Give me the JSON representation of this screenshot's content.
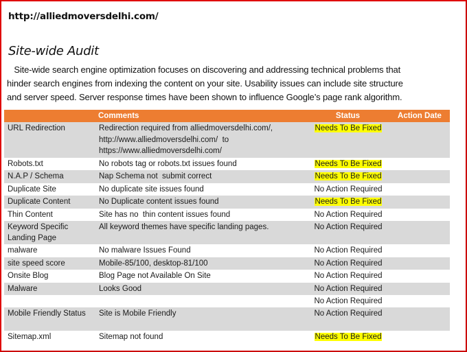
{
  "header": {
    "url": "http://alliedmoversdelhi.com/",
    "title": "Site-wide Audit"
  },
  "intro": {
    "lines": [
      "   Site-wide search engine optimization focuses on discovering and addressing technical problems that",
      "hinder search engines from indexing the content on your site. Usability issues can include site structure",
      "and server speed. Server response times have been shown to influence Google’s page rank algorithm."
    ]
  },
  "table": {
    "columns": [
      "",
      "Comments",
      "Status",
      "Action Date"
    ],
    "rows": [
      {
        "item": "URL Redirection",
        "comment_lines": [
          "Redirection required from alliedmoversdelhi.com/,",
          "http://www.alliedmoversdelhi.com/  to",
          "https://www.alliedmoversdelhi.com/"
        ],
        "status": "Needs To Be Fixed",
        "action_date": ""
      },
      {
        "item": "Robots.txt",
        "comment_lines": [
          "No robots tag or robots.txt issues found"
        ],
        "status": "Needs To Be Fixed",
        "action_date": ""
      },
      {
        "item": "N.A.P / Schema",
        "comment_lines": [
          "Nap Schema not  submit correct"
        ],
        "status": "Needs To Be Fixed",
        "action_date": ""
      },
      {
        "item": "Duplicate Site",
        "comment_lines": [
          "No duplicate site issues found"
        ],
        "status": "No Action Required",
        "action_date": ""
      },
      {
        "item": "Duplicate Content",
        "comment_lines": [
          "No Duplicate content issues found"
        ],
        "status": "Needs To Be Fixed",
        "action_date": ""
      },
      {
        "item": "Thin Content",
        "comment_lines": [
          "Site has no  thin content issues found"
        ],
        "status": "No Action Required",
        "action_date": ""
      },
      {
        "item": "Keyword Specific Landing Page",
        "comment_lines": [
          "All keyword themes have specific landing pages."
        ],
        "status": "No Action Required",
        "action_date": ""
      },
      {
        "item": "malware",
        "comment_lines": [
          "No malware Issues Found"
        ],
        "status": "No Action Required",
        "action_date": ""
      },
      {
        "item": "site speed score",
        "comment_lines": [
          "Mobile-85/100, desktop-81/100"
        ],
        "status": "No Action Required",
        "action_date": ""
      },
      {
        "item": "Onsite Blog",
        "comment_lines": [
          "Blog Page not Available On Site"
        ],
        "status": "No Action Required",
        "action_date": ""
      },
      {
        "item": "Malware",
        "comment_lines": [
          "Looks Good"
        ],
        "status": "No Action Required",
        "action_date": ""
      },
      {
        "item": "",
        "comment_lines": [
          ""
        ],
        "status": "No Action Required",
        "action_date": ""
      },
      {
        "item": "Mobile Friendly Status",
        "comment_lines": [
          "Site is Mobile Friendly"
        ],
        "status": "No Action Required",
        "action_date": ""
      },
      {
        "item": "Sitemap.xml",
        "comment_lines": [
          "Sitemap not found"
        ],
        "status": "Needs To Be Fixed",
        "action_date": ""
      }
    ]
  },
  "colors": {
    "header_bg": "#ed7d31",
    "row_shade": "#d9d9d9",
    "highlight": "#ffff00",
    "page_border": "#e00000"
  }
}
